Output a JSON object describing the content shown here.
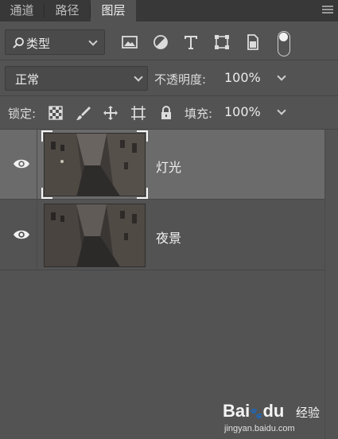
{
  "tabs": [
    {
      "label": "通道",
      "active": false
    },
    {
      "label": "路径",
      "active": false
    },
    {
      "label": "图层",
      "active": true
    }
  ],
  "filter": {
    "kind_label": "类型",
    "icons": [
      "image-filter-icon",
      "adjustment-filter-icon",
      "type-filter-icon",
      "shape-filter-icon",
      "smart-object-filter-icon"
    ],
    "toggle_on": true
  },
  "blend": {
    "mode": "正常",
    "opacity_label": "不透明度:",
    "opacity_value": "100%"
  },
  "lock": {
    "label": "锁定:",
    "icons": [
      "lock-transparent-pixels-icon",
      "lock-image-pixels-icon",
      "lock-position-icon",
      "lock-artboard-icon",
      "lock-all-icon"
    ],
    "fill_label": "填充:",
    "fill_value": "100%"
  },
  "layers": [
    {
      "name": "灯光",
      "visible": true,
      "selected": true
    },
    {
      "name": "夜景",
      "visible": true,
      "selected": false
    }
  ],
  "watermark": {
    "brand_left": "Bai",
    "brand_mid": "du",
    "brand_right": "经验",
    "url": "jingyan.baidu.com"
  },
  "colors": {
    "panel_bg": "#535353",
    "tab_bar_bg": "#383838",
    "selected_row_bg": "#6b6b6b"
  }
}
